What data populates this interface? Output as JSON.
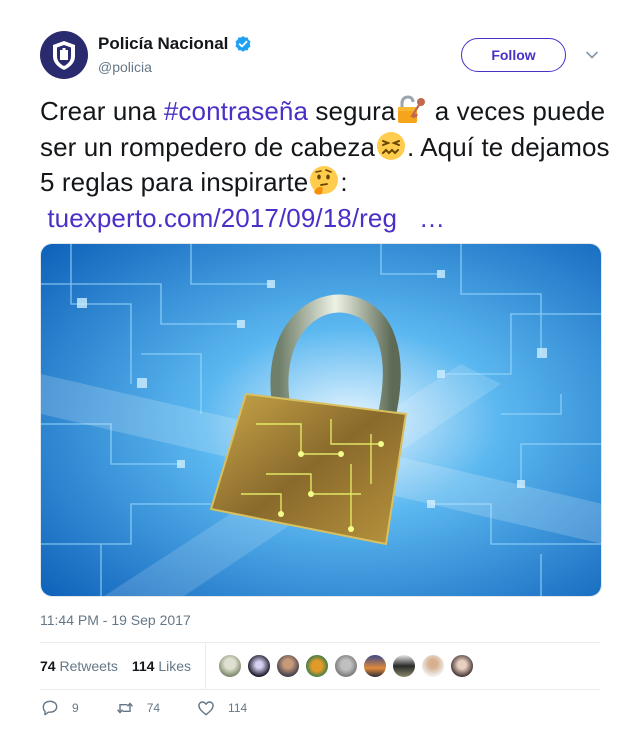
{
  "author": {
    "display_name": "Policía Nacional",
    "handle": "@policia",
    "verified_icon": "verified-badge-icon",
    "avatar_icon": "police-crest-icon"
  },
  "follow_button": {
    "label": "Follow"
  },
  "tweet": {
    "text_part1": "Crear una ",
    "hashtag": "#contraseña",
    "text_part2": " segura",
    "text_part3": " a veces puede ser un rompedero de cabeza",
    "text_part4": ". Aquí te dejamos 5 reglas para inspirarte",
    "text_part5": ":",
    "link": "tuexperto.com/2017/09/18/reg",
    "link_ellipsis": "…",
    "emojis": [
      "unlocked-padlock-key-icon",
      "confounded-face-icon",
      "thinking-face-icon"
    ]
  },
  "media": {
    "icon": "padlock-circuit-image"
  },
  "timestamp": "11:44 PM - 19 Sep 2017",
  "stats": {
    "retweets_count": "74",
    "retweets_label": "Retweets",
    "likes_count": "114",
    "likes_label": "Likes"
  },
  "actions": {
    "reply_count": "9",
    "retweet_count": "74",
    "like_count": "114"
  },
  "colors": {
    "accent": "#4b2fc7",
    "text": "#14171a",
    "secondary": "#657786",
    "verified": "#1da1f2"
  }
}
